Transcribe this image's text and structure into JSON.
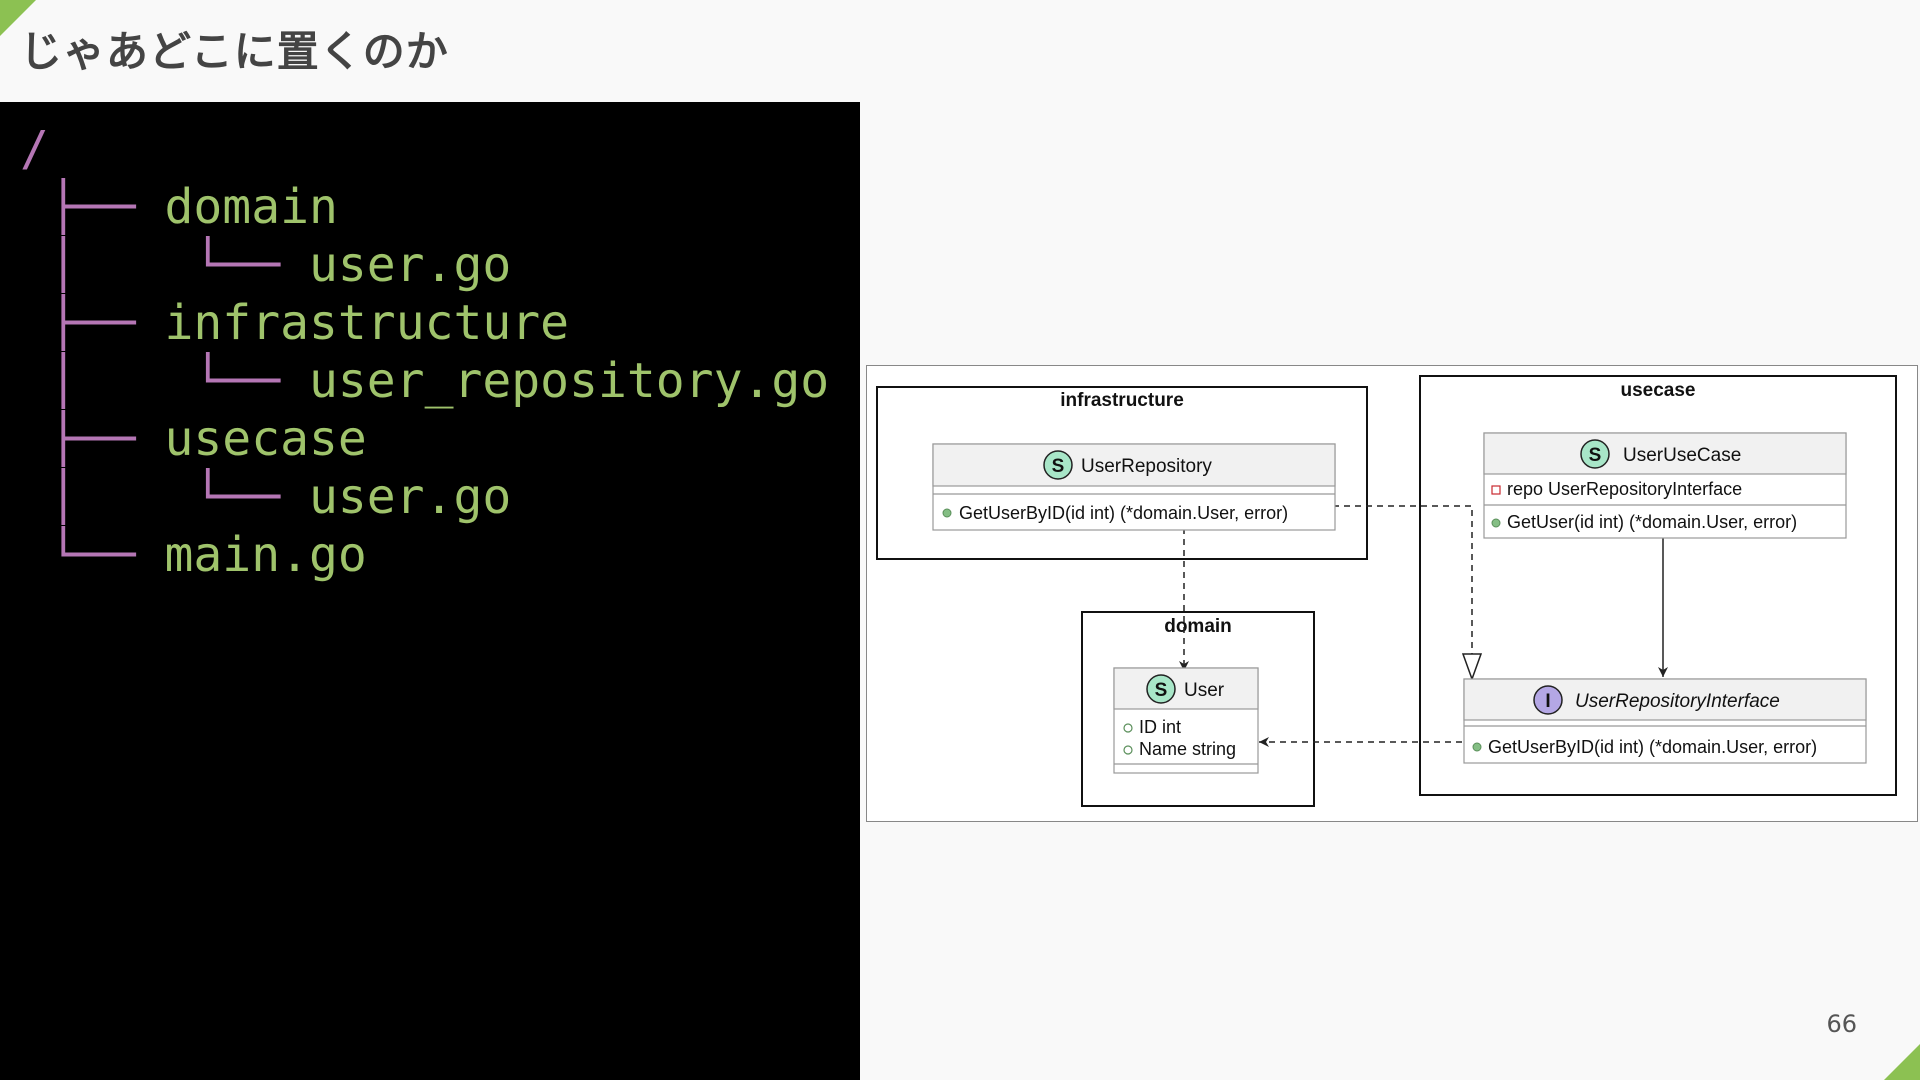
{
  "slide": {
    "title": "じゃあどこに置くのか",
    "page_number": "66",
    "accent_color": "#8cc152"
  },
  "tree": {
    "root": "/",
    "rows": [
      {
        "prefix": " ├── ",
        "name": "domain"
      },
      {
        "prefix": " │    └── ",
        "name": "user.go"
      },
      {
        "prefix": " ├── ",
        "name": "infrastructure"
      },
      {
        "prefix": " │    └── ",
        "name": "user_repository.go"
      },
      {
        "prefix": " ├── ",
        "name": "usecase"
      },
      {
        "prefix": " │    └── ",
        "name": "user.go"
      },
      {
        "prefix": " └── ",
        "name": "main.go"
      }
    ],
    "branch_color": "#b576b5",
    "name_color": "#9fc36b"
  },
  "diagram": {
    "packages": {
      "infrastructure": "infrastructure",
      "usecase": "usecase",
      "domain": "domain"
    },
    "classes": {
      "user_repository": {
        "stereotype": "S",
        "name": "UserRepository",
        "methods": [
          "GetUserByID(id int) (*domain.User, error)"
        ]
      },
      "user_usecase": {
        "stereotype": "S",
        "name": "UserUseCase",
        "fields": [
          "repo UserRepositoryInterface"
        ],
        "methods": [
          "GetUser(id int) (*domain.User, error)"
        ]
      },
      "user_repository_interface": {
        "stereotype": "I",
        "name": "UserRepositoryInterface",
        "methods": [
          "GetUserByID(id int) (*domain.User, error)"
        ]
      },
      "user": {
        "stereotype": "S",
        "name": "User",
        "fields": [
          "ID int",
          "Name string"
        ]
      }
    },
    "colors": {
      "struct_badge": "#a8e6c8",
      "interface_badge": "#b4a7e5",
      "class_header": "#f1f1f1",
      "public_marker": "#84be84",
      "private_marker": "#c82930"
    }
  }
}
